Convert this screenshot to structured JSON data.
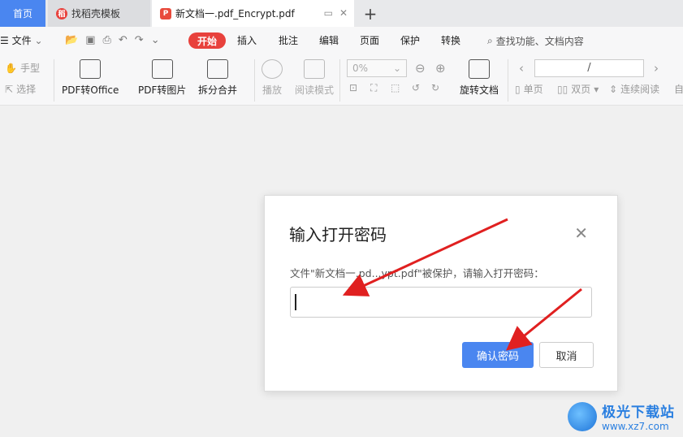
{
  "tabs": {
    "home": "首页",
    "template": "找稻壳模板",
    "document": "新文档一.pdf_Encrypt.pdf",
    "new_tab_icon": "plus-icon"
  },
  "menu": {
    "file": "文件",
    "start": "开始",
    "insert": "插入",
    "annotate": "批注",
    "edit": "编辑",
    "page": "页面",
    "protect": "保护",
    "convert": "转换",
    "search": "查找功能、文档内容"
  },
  "toolbar": {
    "hand": "手型",
    "select": "选择",
    "pdf_to_office": "PDF转Office",
    "pdf_to_image": "PDF转图片",
    "split_merge": "拆分合并",
    "play": "播放",
    "read_mode": "阅读模式",
    "zoom": "0%",
    "rotate_doc": "旋转文档",
    "page_input": "/",
    "single_page": "单页",
    "double_page": "双页",
    "continuous": "连续阅读",
    "auto": "自"
  },
  "dialog": {
    "title": "输入打开密码",
    "message": "文件\"新文档一.pd...ypt.pdf\"被保护，请输入打开密码：",
    "password_value": "",
    "confirm": "确认密码",
    "cancel": "取消"
  },
  "watermark": {
    "name": "极光下载站",
    "url": "www.xz7.com"
  },
  "colors": {
    "accent": "#4a86f0",
    "start_pill": "#e8413c",
    "arrow": "#e02020"
  }
}
